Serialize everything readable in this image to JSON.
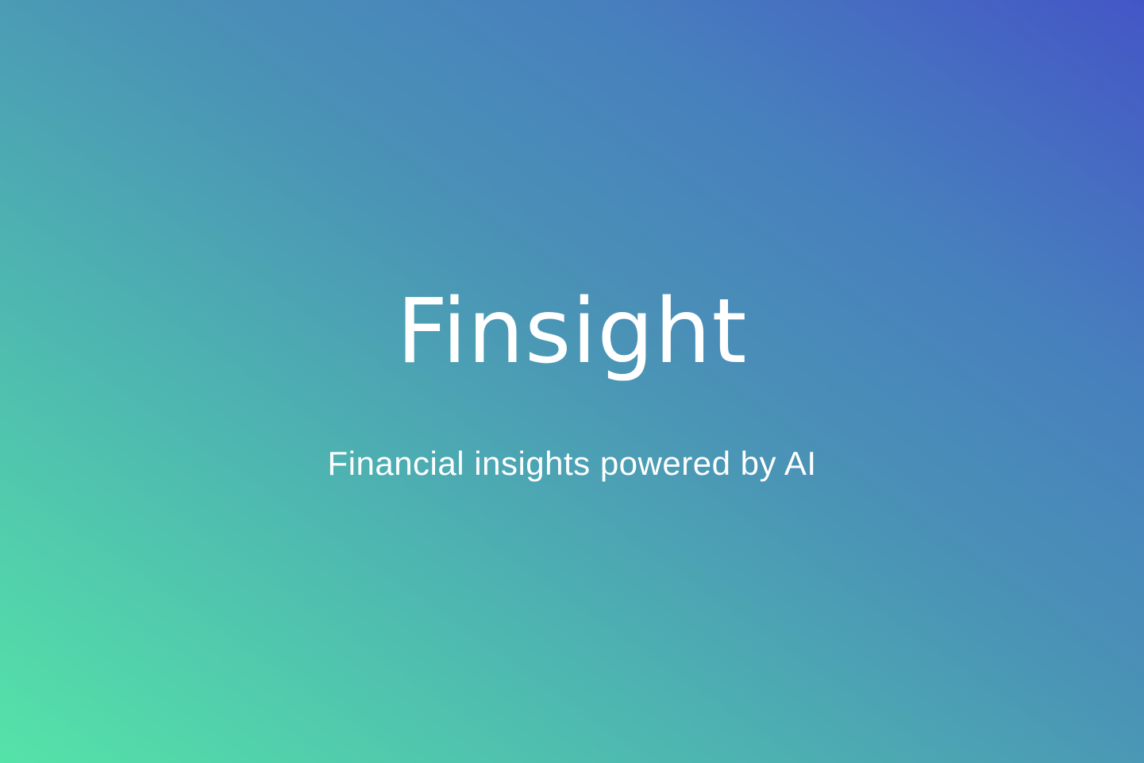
{
  "app": {
    "title": "Finsight",
    "tagline": "Financial insights powered by AI"
  },
  "colors": {
    "gradient_start": "#55e3a8",
    "gradient_end": "#4456c6",
    "text": "#ffffff"
  }
}
